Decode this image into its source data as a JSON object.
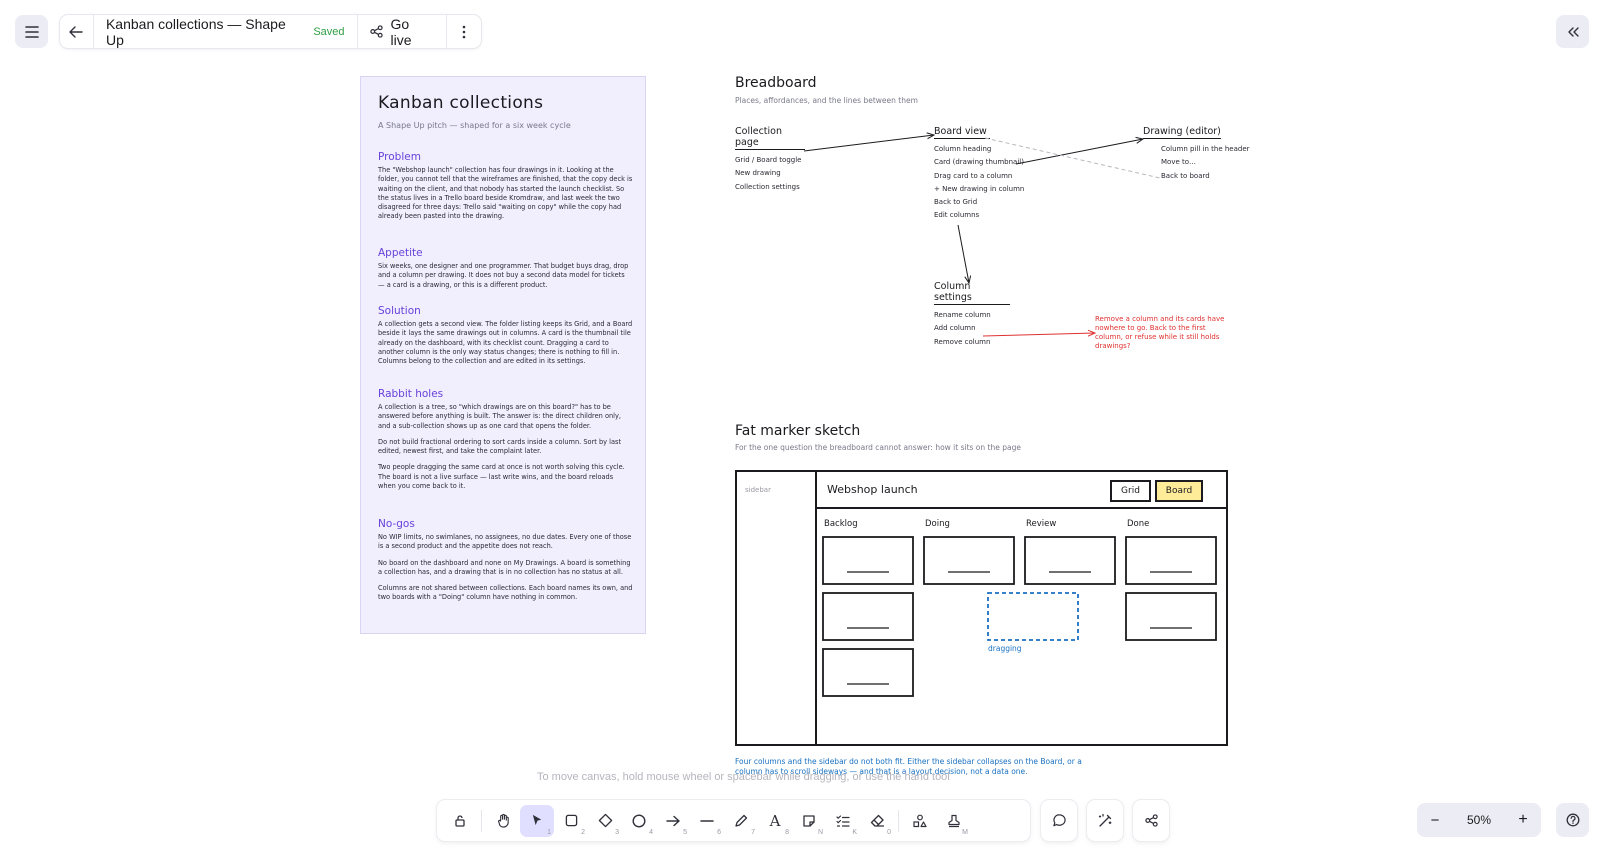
{
  "header": {
    "title": "Kanban collections — Shape Up",
    "saved": "Saved",
    "go_live": "Go live"
  },
  "pitch": {
    "title": "Kanban collections",
    "subtitle": "A Shape Up pitch — shaped for a six week cycle",
    "sections": [
      {
        "heading": "Problem",
        "paragraphs": [
          "The \"Webshop launch\" collection has four drawings in it. Looking at the folder, you cannot tell that the wireframes are finished, that the copy deck is waiting on the client, and that nobody has started the launch checklist. So the status lives in a Trello board beside Kromdraw, and last week the two disagreed for three days: Trello said \"waiting on copy\" while the copy had already been pasted into the drawing."
        ]
      },
      {
        "heading": "Appetite",
        "paragraphs": [
          "Six weeks, one designer and one programmer. That budget buys drag, drop and a column per drawing. It does not buy a second data model for tickets — a card is a drawing, or this is a different product."
        ]
      },
      {
        "heading": "Solution",
        "paragraphs": [
          "A collection gets a second view. The folder listing keeps its Grid, and a Board beside it lays the same drawings out in columns. A card is the thumbnail tile already on the dashboard, with its checklist count. Dragging a card to another column is the only way status changes; there is nothing to fill in. Columns belong to the collection and are edited in its settings."
        ]
      },
      {
        "heading": "Rabbit holes",
        "paragraphs": [
          "A collection is a tree, so \"which drawings are on this board?\" has to be answered before anything is built. The answer is: the direct children only, and a sub-collection shows up as one card that opens the folder.",
          "Do not build fractional ordering to sort cards inside a column. Sort by last edited, newest first, and take the complaint later.",
          "Two people dragging the same card at once is not worth solving this cycle. The board is not a live surface — last write wins, and the board reloads when you come back to it."
        ]
      },
      {
        "heading": "No-gos",
        "paragraphs": [
          "No WIP limits, no swimlanes, no assignees, no due dates. Every one of those is a second product and the appetite does not reach.",
          "No board on the dashboard and none on My Drawings. A board is something a collection has, and a drawing that is in no collection has no status at all.",
          "Columns are not shared between collections. Each board names its own, and two boards with a \"Doing\" column have nothing in common."
        ]
      }
    ]
  },
  "breadboard": {
    "title": "Breadboard",
    "subtitle": "Places, affordances, and the lines between them",
    "places": [
      {
        "name": "Collection page",
        "affordances": [
          "Grid / Board toggle",
          "New drawing",
          "Collection settings"
        ]
      },
      {
        "name": "Board view",
        "affordances": [
          "Column heading",
          "Card (drawing thumbnail)",
          "Drag card to a column",
          "+ New drawing in column",
          "Back to Grid",
          "Edit columns"
        ]
      },
      {
        "name": "Drawing (editor)",
        "affordances": [
          "Column pill in the header",
          "Move to…",
          "Back to board"
        ]
      },
      {
        "name": "Column settings",
        "affordances": [
          "Rename column",
          "Add column",
          "Remove column"
        ]
      }
    ],
    "note": "Remove a column and its cards have nowhere to go. Back to the first column, or refuse while it still holds drawings?"
  },
  "sketch": {
    "title": "Fat marker sketch",
    "subtitle": "For the one question the breadboard cannot answer: how it sits on the page",
    "sidebar": "sidebar",
    "board_title": "Webshop launch",
    "toggle_grid": "Grid",
    "toggle_board": "Board",
    "columns": [
      "Backlog",
      "Doing",
      "Review",
      "Done"
    ],
    "dragging": "dragging",
    "caption": "Four columns and the sidebar do not both fit. Either the sidebar collapses on the Board, or a column has to scroll sideways — and that is a layout decision, not a data one."
  },
  "hint": "To move canvas, hold mouse wheel or spacebar while dragging, or use the hand tool",
  "toolbar": {
    "tools": [
      {
        "icon": "lock-icon",
        "key": ""
      },
      {
        "icon": "hand-icon",
        "key": ""
      },
      {
        "icon": "pointer-icon",
        "key": "1"
      },
      {
        "icon": "rectangle-icon",
        "key": "2"
      },
      {
        "icon": "diamond-icon",
        "key": "3"
      },
      {
        "icon": "ellipse-icon",
        "key": "4"
      },
      {
        "icon": "arrow-icon",
        "key": "5"
      },
      {
        "icon": "line-icon",
        "key": "6"
      },
      {
        "icon": "pencil-icon",
        "key": "7"
      },
      {
        "icon": "text-icon",
        "key": "8"
      },
      {
        "icon": "sticky-note-icon",
        "key": "N"
      },
      {
        "icon": "checklist-icon",
        "key": "K"
      },
      {
        "icon": "eraser-icon",
        "key": "0"
      },
      {
        "icon": "shapes-icon",
        "key": ""
      },
      {
        "icon": "stamp-icon",
        "key": "M"
      }
    ]
  },
  "zoom": {
    "value": "50%",
    "minus": "−",
    "plus": "+"
  }
}
